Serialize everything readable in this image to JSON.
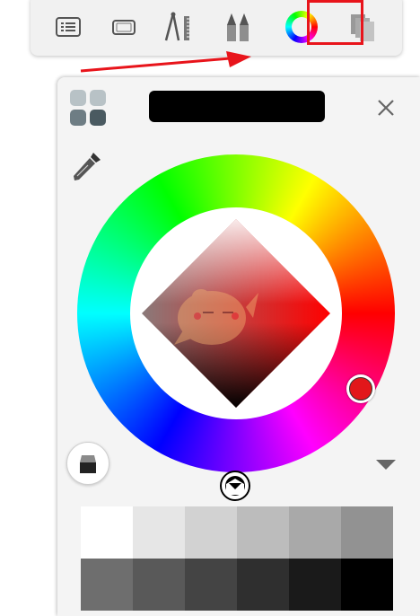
{
  "toolbar": {
    "tools": [
      {
        "icon": "layers-list-icon",
        "x": 0
      },
      {
        "icon": "canvas-icon",
        "x": 1
      },
      {
        "icon": "ruler-guides-icon",
        "x": 2
      },
      {
        "icon": "brush-library-icon",
        "x": 3
      },
      {
        "icon": "color-wheel-icon",
        "x": 4,
        "highlighted": true
      },
      {
        "icon": "copic-library-icon",
        "x": 5
      }
    ]
  },
  "annotation": {
    "highlight_color": "#e8141b",
    "arrow_color": "#e8141b"
  },
  "color_panel": {
    "current_color": "#000000",
    "hue_marker_color": "#e2171a",
    "palette_top_row": [
      "#ffffff",
      "#e6e6e6",
      "#d2d2d2",
      "#bcbcbc",
      "#a9a9a9",
      "#929292"
    ],
    "palette_bottom_row": [
      "#6e6e6e",
      "#595959",
      "#444444",
      "#2f2f2f",
      "#1a1a1a",
      "#000000"
    ]
  }
}
